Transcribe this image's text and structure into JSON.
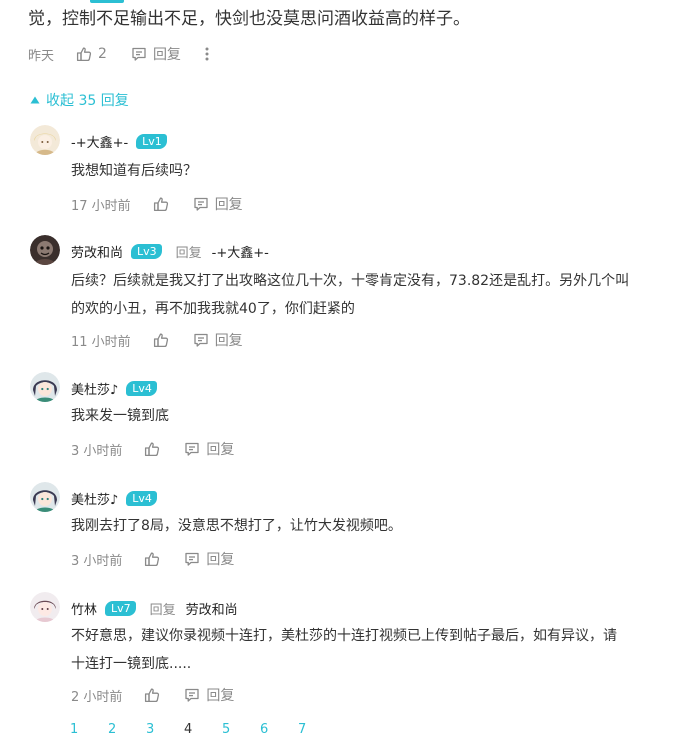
{
  "parent": {
    "text_tail": "觉，控制不足输出不足，快剑也没莫思问酒收益高的样子。",
    "time": "昨天",
    "likes": "2",
    "reply_label": "回复"
  },
  "collapse_label": "收起 35 回复",
  "reply_word": "回复",
  "replies": [
    {
      "user": "-+大鑫+-",
      "level": "Lv1",
      "lines": [
        "我想知道有后续吗？"
      ],
      "time": "17 小时前"
    },
    {
      "user": "劳改和尚",
      "level": "Lv3",
      "reply_to": "-+大鑫+-",
      "lines": [
        "后续？后续就是我又打了出攻略这位几十次，十零肯定没有，73.82还是乱打。另外几个叫",
        "的欢的小丑，再不加我我就40了，你们赶紧的"
      ],
      "time": "11 小时前"
    },
    {
      "user": "美杜莎♪",
      "level": "Lv4",
      "lines": [
        "我来发一镜到底"
      ],
      "time": "3 小时前"
    },
    {
      "user": "美杜莎♪",
      "level": "Lv4",
      "lines": [
        "我刚去打了8局，没意思不想打了，让竹大发视频吧。"
      ],
      "time": "3 小时前"
    },
    {
      "user": "竹林",
      "level": "Lv7",
      "reply_to": "劳改和尚",
      "lines": [
        "不好意思，建议你录视频十连打，美杜莎的十连打视频已上传到帖子最后，如有异议，请",
        "十连打一镜到底....."
      ],
      "time": "2 小时前"
    }
  ],
  "pagination": [
    "1",
    "2",
    "3",
    "4",
    "5",
    "6",
    "7"
  ],
  "current_page": "4",
  "colors": {
    "accent": "#2bbfd3",
    "muted": "#8a8a8a",
    "text": "#333333"
  }
}
